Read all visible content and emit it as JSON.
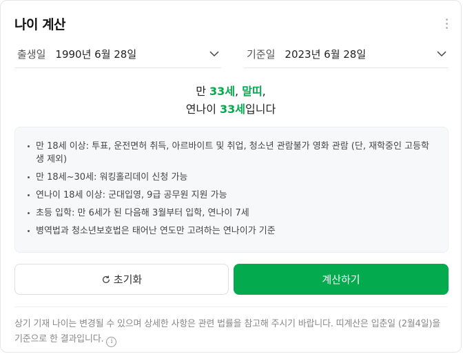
{
  "header": {
    "title": "나이 계산",
    "more_icon": "more-vertical-icon"
  },
  "birth": {
    "label": "출생일",
    "value": "1990년 6월 28일"
  },
  "base": {
    "label": "기준일",
    "value": "2023년 6월 28일"
  },
  "result": {
    "line1_prefix": "만 ",
    "man_age": "33세",
    "sep1": ", ",
    "zodiac": "말띠",
    "sep2": ",",
    "line2_prefix": "연나이 ",
    "year_age": "33세",
    "line2_suffix": "입니다"
  },
  "info_items": [
    "만 18세 이상: 투표, 운전면허 취득, 아르바이트 및 취업, 청소년 관람불가 영화 관람 (단, 재학중인 고등학생 제외)",
    "만 18세~30세: 워킹홀리데이 신청 가능",
    "연나이 18세 이상: 군대입영, 9급 공무원 지원 가능",
    "초등 입학: 만 6세가 된 다음해 3월부터 입학, 연나이 7세",
    "병역법과 청소년보호법은 태어난 연도만 고려하는 연나이가 기준"
  ],
  "buttons": {
    "reset": "초기화",
    "calculate": "계산하기"
  },
  "footnote": "상기 기재 나이는 변경될 수 있으며 상세한 사항은 관련 법률을 참고해 주시기 바랍니다. 띠계산은 입춘일 (2월4일)을 기준으로 한 결과입니다.",
  "colors": {
    "accent": "#03aa4e"
  }
}
